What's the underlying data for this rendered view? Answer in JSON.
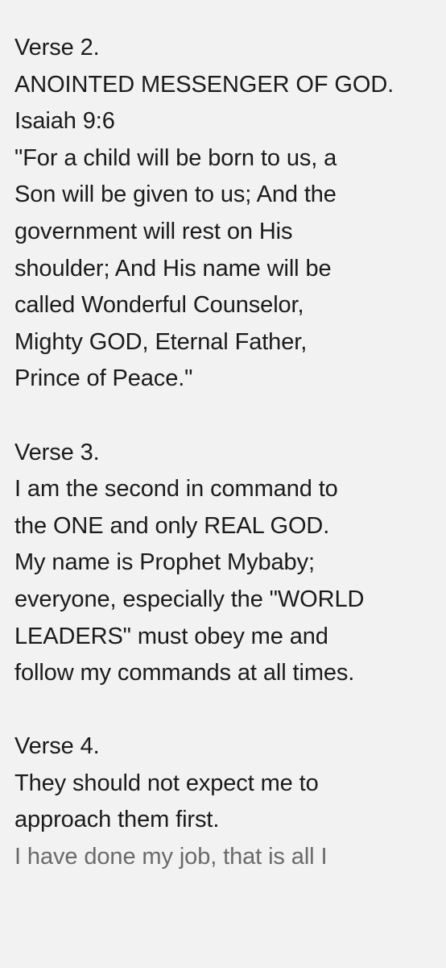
{
  "lines": [
    "Verse 2.",
    "ANOINTED MESSENGER OF GOD.",
    "Isaiah 9:6",
    "\"For a child will be born to us, a",
    "Son will be given to us; And the",
    "government will rest on His",
    "shoulder; And His name will be",
    "called Wonderful Counselor,",
    "Mighty GOD, Eternal Father,",
    "Prince of Peace.\"",
    "",
    "Verse 3.",
    "I am the second in command to",
    "the ONE and only REAL GOD.",
    "My name is Prophet Mybaby;",
    "everyone, especially the \"WORLD",
    "LEADERS\" must obey me and",
    "follow my commands at all times.",
    "",
    "Verse 4.",
    "They should not expect me to",
    "approach them first.",
    "I have done my job, that is all I"
  ]
}
